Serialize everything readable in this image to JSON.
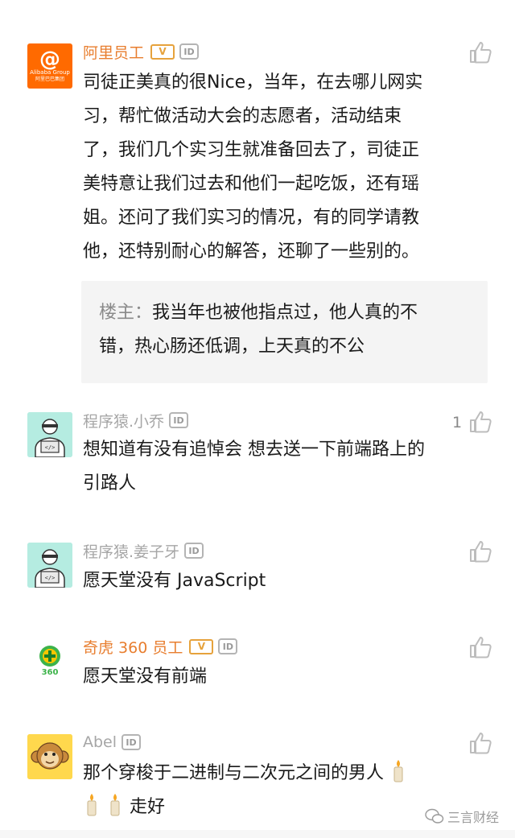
{
  "comments": [
    {
      "author": "阿里员工",
      "badge_v": "V",
      "badge_id": "ID",
      "text": "司徒正美真的很Nice，当年，在去哪儿网实\n习，帮忙做活动大会的志愿者，活动结束\n了，我们几个实习生就准备回去了，司徒正\n美特意让我们过去和他们一起吃饭，还有瑶\n姐。还问了我们实习的情况，有的同学请教\n他，还特别耐心的解答，还聊了一些别的。",
      "avatar_brand": "Alibaba Group",
      "avatar_brand_cn": "阿里巴巴集团",
      "reply": {
        "author": "楼主：",
        "text": "我当年也被他指点过，他人真的不\n错，热心肠还低调，上天真的不公"
      }
    },
    {
      "author": "程序猿.小乔",
      "badge_id": "ID",
      "text": "想知道有没有追悼会 想去送一下前端路上的\n引路人",
      "like_count": "1"
    },
    {
      "author": "程序猿.姜子牙",
      "badge_id": "ID",
      "text": "愿天堂没有 JavaScript"
    },
    {
      "author": "奇虎 360 员工",
      "badge_v": "V",
      "badge_id": "ID",
      "text": "愿天堂没有前端",
      "avatar_brand": "360"
    },
    {
      "author": "Abel",
      "badge_id": "ID",
      "text_line1": "那个穿梭于二进制与二次元之间的男人",
      "text_line2": "走好"
    }
  ],
  "watermark": "三言财经",
  "colors": {
    "vip_name": "#e87e2f",
    "normal_name": "#a6a6a6",
    "alibaba_orange": "#ff6a00",
    "coder_bg": "#b5ece1",
    "reply_bg": "#f4f4f4"
  }
}
